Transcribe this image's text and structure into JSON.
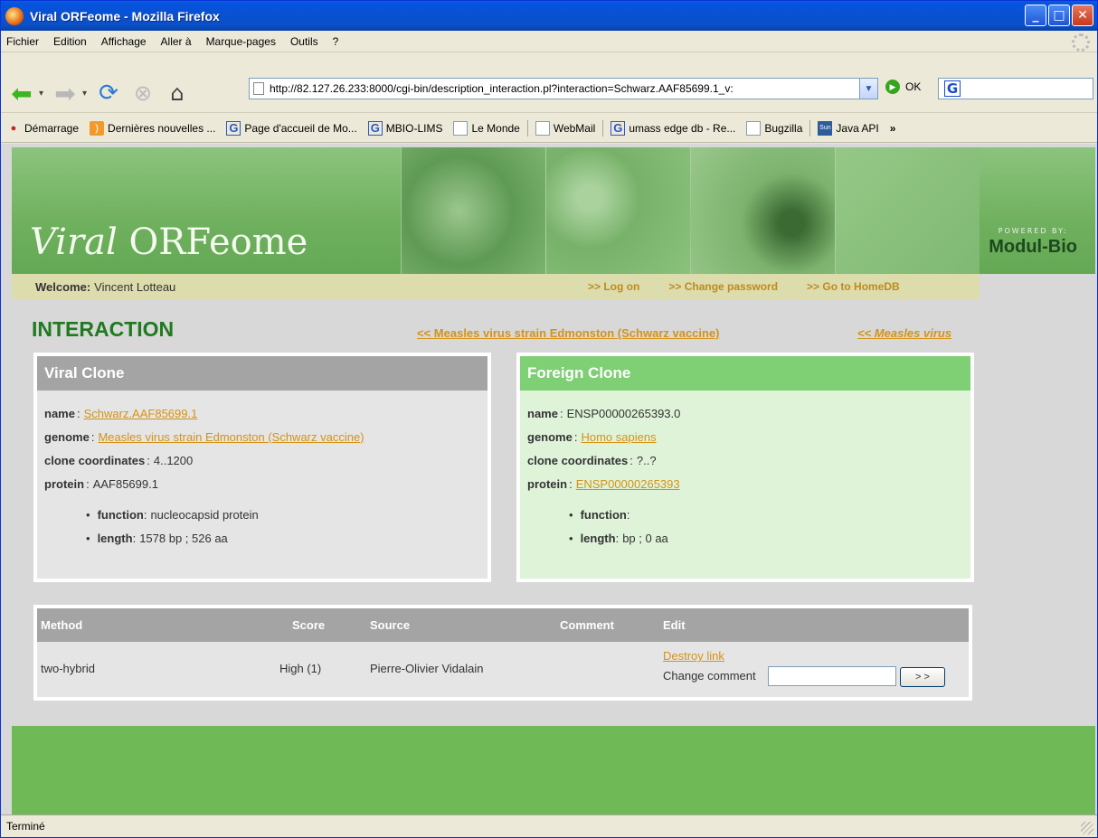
{
  "window": {
    "title": "Viral ORFeome - Mozilla Firefox"
  },
  "menu": [
    "Fichier",
    "Edition",
    "Affichage",
    "Aller à",
    "Marque-pages",
    "Outils",
    "?"
  ],
  "nav": {
    "url": "http://82.127.26.233:8000/cgi-bin/description_interaction.pl?interaction=Schwarz.AAF85699.1_v:",
    "go_label": "OK"
  },
  "bookmarks": [
    {
      "label": "Démarrage",
      "icon": "firefox-icon"
    },
    {
      "label": "Dernières nouvelles ...",
      "icon": "rss-icon"
    },
    {
      "label": "Page d'accueil de Mo...",
      "icon": "google-icon"
    },
    {
      "label": "MBIO-LIMS",
      "icon": "google-icon"
    },
    {
      "label": "Le Monde",
      "icon": "page-icon"
    },
    {
      "label": "WebMail",
      "icon": "page-icon"
    },
    {
      "label": "umass edge db - Re...",
      "icon": "google-icon"
    },
    {
      "label": "Bugzilla",
      "icon": "page-icon"
    },
    {
      "label": "Java API",
      "icon": "sun-icon"
    }
  ],
  "bookmarks_more": "»",
  "banner": {
    "brand_italic": "Viral",
    "brand_rest": " ORFeome",
    "powered_by": "POWERED BY:",
    "powered_name": "Modul-Bio"
  },
  "welcome": {
    "label": "Welcome:",
    "user": "Vincent Lotteau",
    "links": [
      ">> Log on",
      ">> Change password",
      ">> Go to HomeDB"
    ]
  },
  "page": {
    "heading": "INTERACTION",
    "strain_link": "<< Measles virus strain Edmonston (Schwarz vaccine)",
    "virus_link": "<< Measles virus"
  },
  "viral": {
    "header": "Viral Clone",
    "name_label": "name",
    "name": "Schwarz.AAF85699.1",
    "genome_label": "genome",
    "genome": "Measles virus strain Edmonston (Schwarz vaccine)",
    "coords_label": "clone coordinates",
    "coords": "4..1200",
    "protein_label": "protein",
    "protein": "AAF85699.1",
    "function_label": "function",
    "function": "nucleocapsid protein",
    "length_label": "length",
    "length": "1578 bp ; 526 aa"
  },
  "foreign": {
    "header": "Foreign Clone",
    "name_label": "name",
    "name": "ENSP00000265393.0",
    "genome_label": "genome",
    "genome": "Homo sapiens",
    "coords_label": "clone coordinates",
    "coords": "?..?",
    "protein_label": "protein",
    "protein": "ENSP00000265393",
    "function_label": "function",
    "function": "",
    "length_label": "length",
    "length": "bp ; 0 aa"
  },
  "table": {
    "headers": [
      "Method",
      "Score",
      "Source",
      "Comment",
      "Edit"
    ],
    "row": {
      "method": "two-hybrid",
      "score": "High (1)",
      "source": "Pierre-Olivier Vidalain",
      "comment": "",
      "destroy": "Destroy link",
      "change_label": "Change comment",
      "button": "> >"
    }
  },
  "status": "Terminé"
}
